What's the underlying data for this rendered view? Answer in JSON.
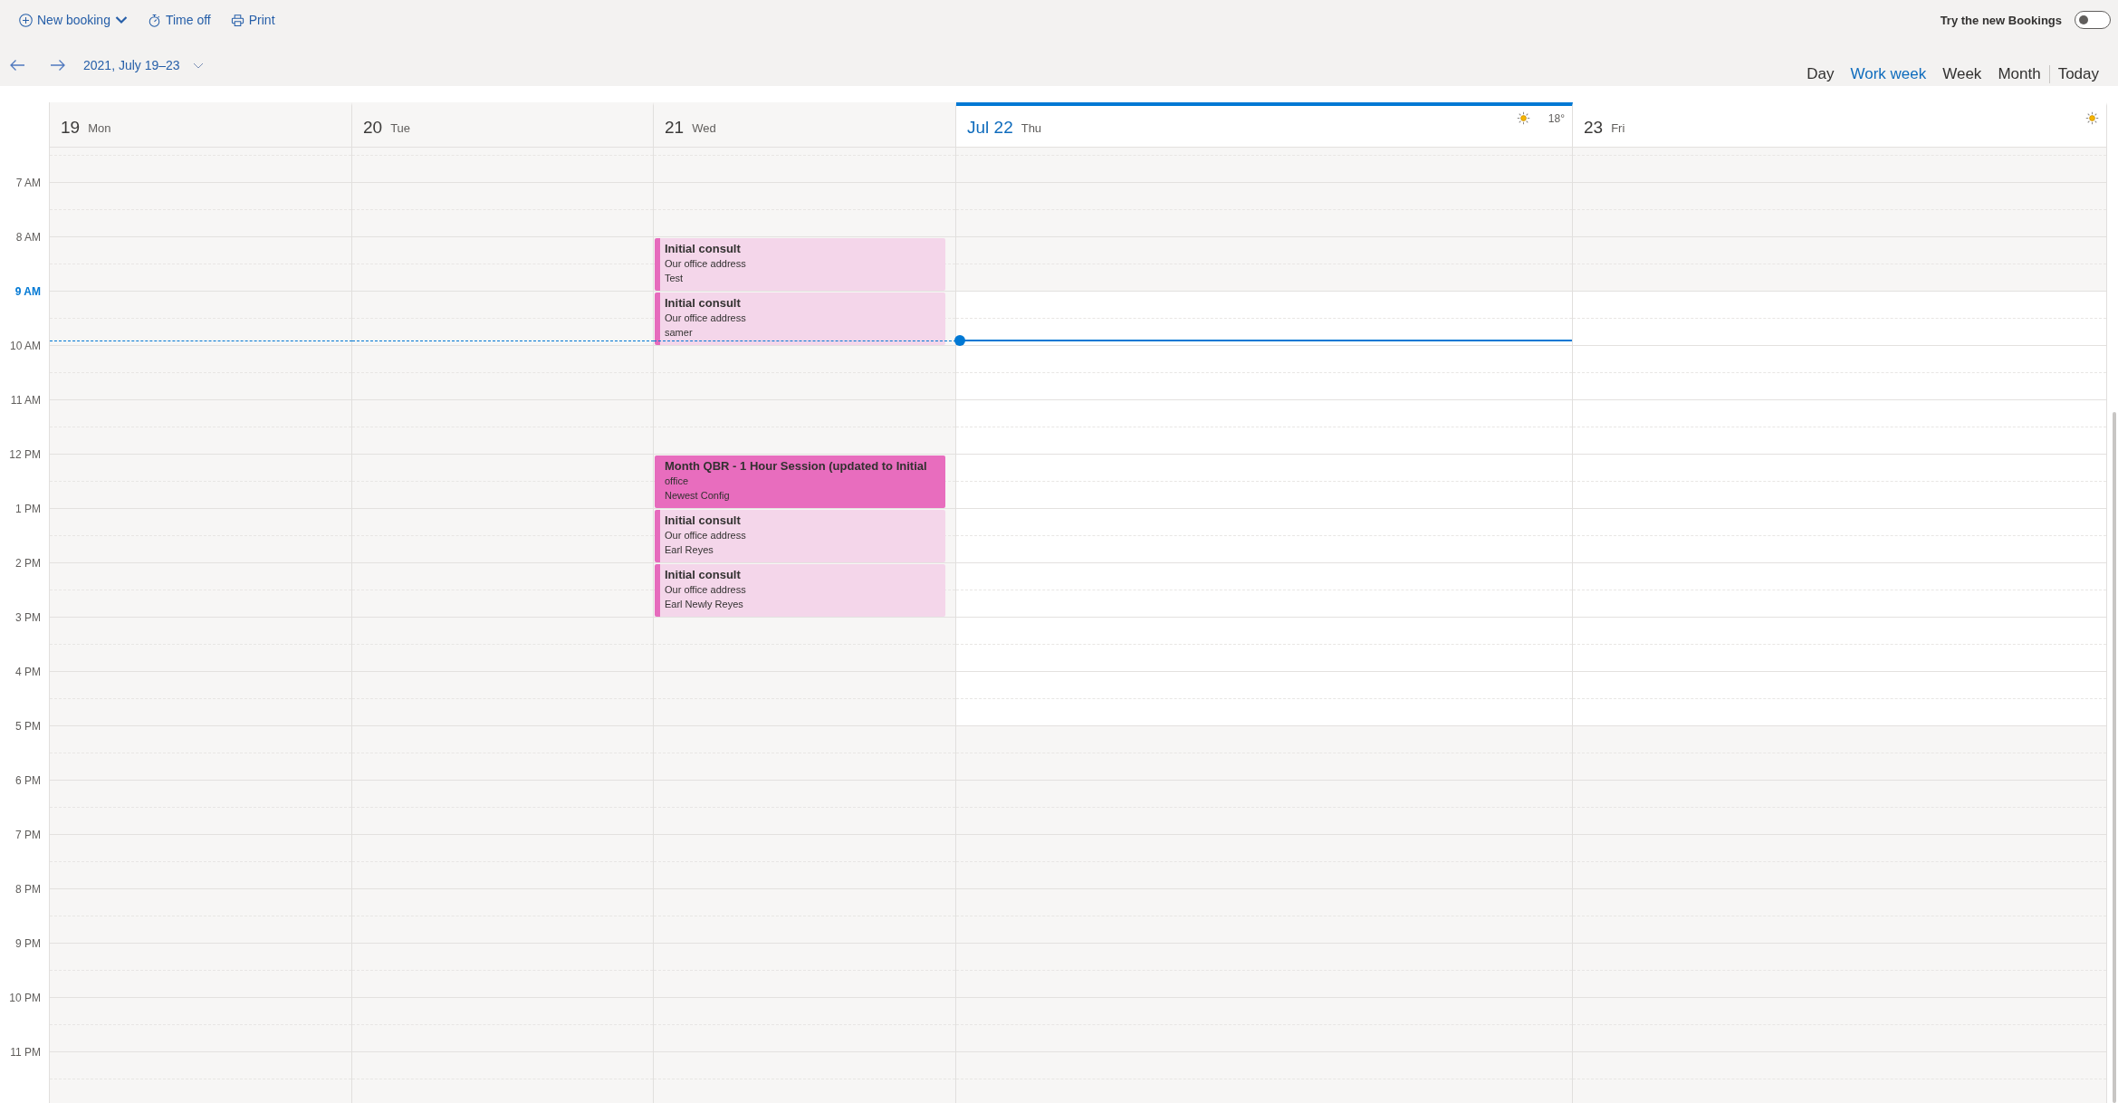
{
  "toolbar": {
    "new_booking": {
      "label": "New booking"
    },
    "time_off": {
      "label": "Time off"
    },
    "print": {
      "label": "Print"
    }
  },
  "preview_toggle": {
    "label": "Try the new Bookings",
    "on": false
  },
  "navigation": {
    "date_range": "2021, July 19–23"
  },
  "views": [
    {
      "label": "Day",
      "selected": false
    },
    {
      "label": "Work week",
      "selected": true
    },
    {
      "label": "Week",
      "selected": false
    },
    {
      "label": "Month",
      "selected": false
    }
  ],
  "today_button": {
    "label": "Today"
  },
  "time_labels": [
    {
      "label": "7 AM",
      "current": false,
      "kind": "off"
    },
    {
      "label": "8 AM",
      "current": false,
      "kind": "off"
    },
    {
      "label": "9 AM",
      "current": true,
      "kind": "working"
    },
    {
      "label": "10 AM",
      "current": false,
      "kind": "working"
    },
    {
      "label": "11 AM",
      "current": false,
      "kind": "working"
    },
    {
      "label": "12 PM",
      "current": false,
      "kind": "working"
    },
    {
      "label": "1 PM",
      "current": false,
      "kind": "working"
    },
    {
      "label": "2 PM",
      "current": false,
      "kind": "working"
    },
    {
      "label": "3 PM",
      "current": false,
      "kind": "working"
    },
    {
      "label": "4 PM",
      "current": false,
      "kind": "working"
    },
    {
      "label": "5 PM",
      "current": false,
      "kind": "off"
    },
    {
      "label": "6 PM",
      "current": false,
      "kind": "off"
    },
    {
      "label": "7 PM",
      "current": false,
      "kind": "off"
    },
    {
      "label": "8 PM",
      "current": false,
      "kind": "off"
    },
    {
      "label": "9 PM",
      "current": false,
      "kind": "off"
    },
    {
      "label": "10 PM",
      "current": false,
      "kind": "off"
    },
    {
      "label": "11 PM",
      "current": false,
      "kind": "off"
    }
  ],
  "days": [
    {
      "date": "19",
      "weekday": "Mon",
      "past": true,
      "today": false,
      "weather": false
    },
    {
      "date": "20",
      "weekday": "Tue",
      "past": true,
      "today": false,
      "weather": false
    },
    {
      "date": "21",
      "weekday": "Wed",
      "past": true,
      "today": false,
      "weather": false,
      "hours": [
        {
          "kind": "free"
        },
        {
          "kind": "booking",
          "title": "Initial consult",
          "location": "Our office address",
          "customer": "Test",
          "selected": false
        },
        {
          "kind": "booking",
          "title": "Initial consult",
          "location": "Our office address",
          "customer": "samer",
          "selected": false
        },
        {
          "kind": "free"
        },
        {
          "kind": "free"
        },
        {
          "kind": "booking",
          "title": "Month QBR - 1 Hour Session (updated to Initial",
          "location": "office",
          "customer": "Newest Config",
          "selected": true
        },
        {
          "kind": "booking",
          "title": "Initial consult",
          "location": "Our office address",
          "customer": "Earl Reyes",
          "selected": false
        },
        {
          "kind": "booking",
          "title": "Initial consult",
          "location": "Our office address",
          "customer": "Earl Newly Reyes",
          "selected": false
        }
      ]
    },
    {
      "date": "Jul 22",
      "weekday": "Thu",
      "past": false,
      "today": true,
      "weather": true,
      "temperature": "18°"
    },
    {
      "date": "23",
      "weekday": "Fri",
      "past": false,
      "today": false,
      "weather": true
    }
  ]
}
